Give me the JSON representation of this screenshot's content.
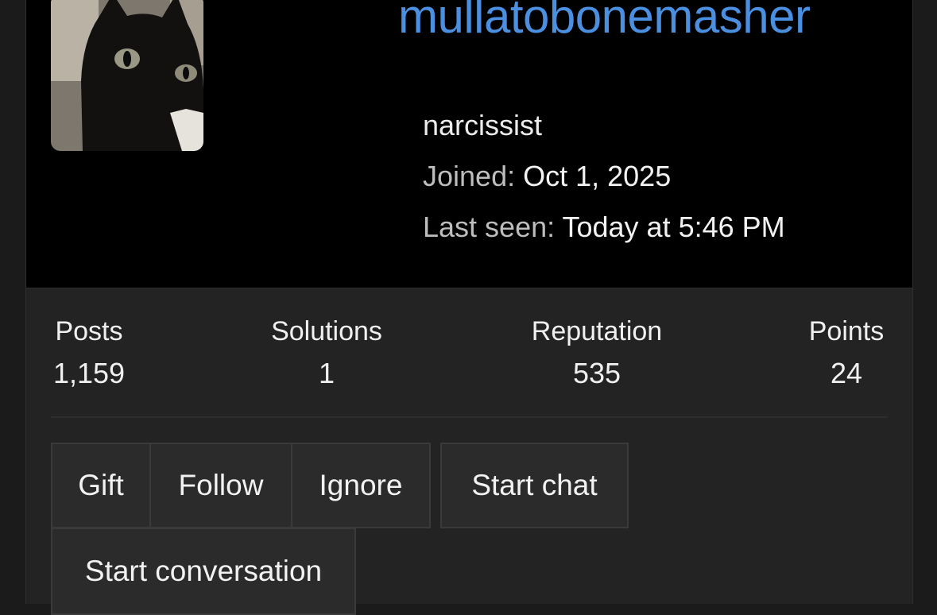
{
  "profile": {
    "username": "mullatobonemasher",
    "title": "narcissist",
    "joined_label": "Joined:",
    "joined_value": "Oct 1, 2025",
    "last_seen_label": "Last seen:",
    "last_seen_value": "Today at 5:46 PM",
    "avatar_icon": "cat-avatar"
  },
  "stats": [
    {
      "label": "Posts",
      "value": "1,159"
    },
    {
      "label": "Solutions",
      "value": "1"
    },
    {
      "label": "Reputation",
      "value": "535"
    },
    {
      "label": "Points",
      "value": "24"
    }
  ],
  "actions": {
    "gift": "Gift",
    "follow": "Follow",
    "ignore": "Ignore",
    "start_chat": "Start chat",
    "start_conversation": "Start conversation"
  },
  "colors": {
    "username": "#4a8fe0",
    "banner": "#000000",
    "card": "#232323",
    "button": "#2b2b2b"
  }
}
